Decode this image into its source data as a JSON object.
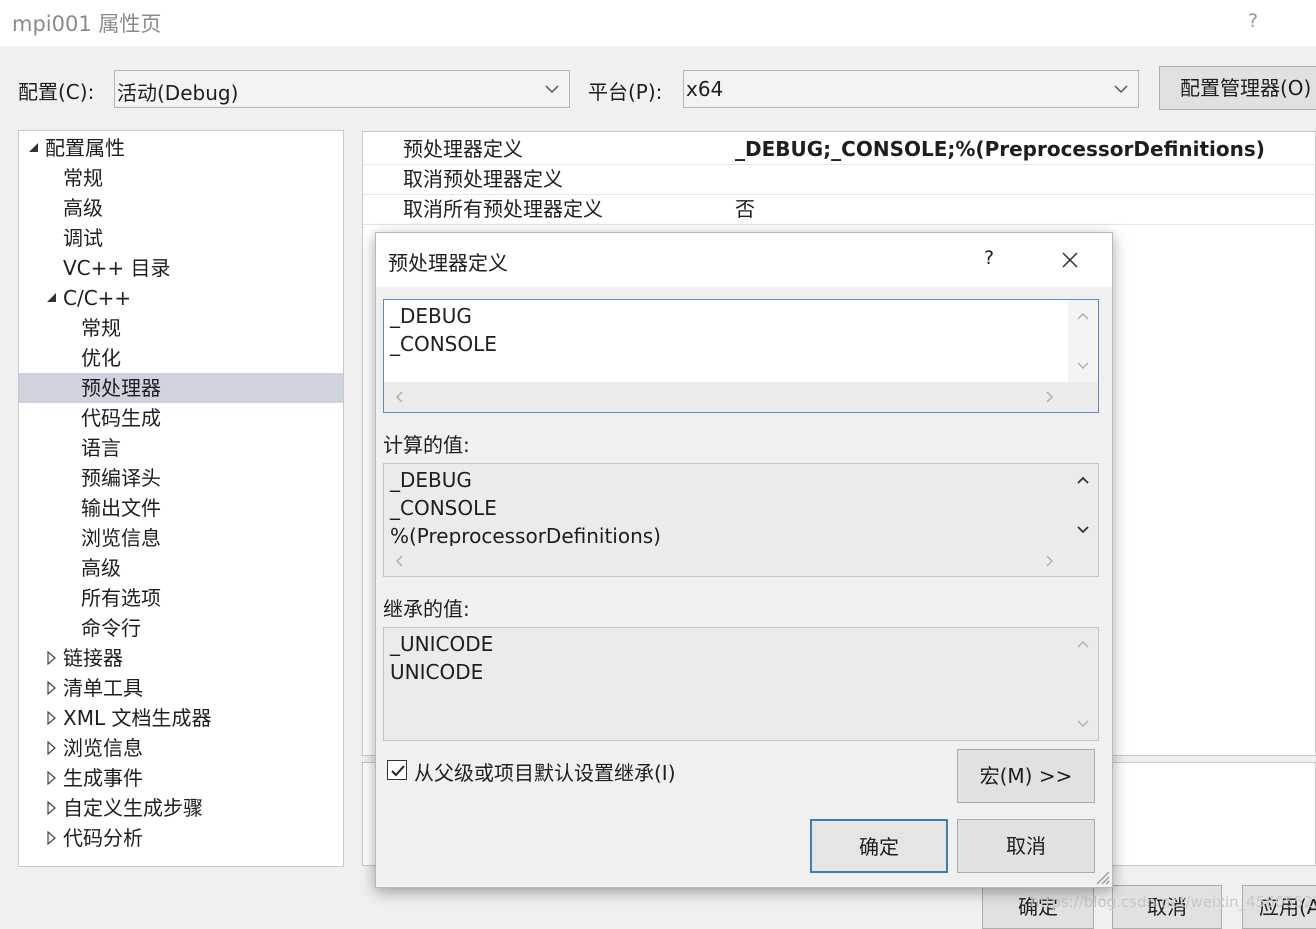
{
  "window": {
    "title": "mpi001 属性页",
    "help": "?"
  },
  "toolbar": {
    "config_label": "配置(C):",
    "config_value": "活动(Debug)",
    "platform_label": "平台(P):",
    "platform_value": "x64",
    "config_manager_button": "配置管理器(O)"
  },
  "tree": {
    "items": [
      {
        "label": "配置属性",
        "level": 0,
        "expander": "expanded"
      },
      {
        "label": "常规",
        "level": 1,
        "expander": "none"
      },
      {
        "label": "高级",
        "level": 1,
        "expander": "none"
      },
      {
        "label": "调试",
        "level": 1,
        "expander": "none"
      },
      {
        "label": "VC++ 目录",
        "level": 1,
        "expander": "none"
      },
      {
        "label": "C/C++",
        "level": 1,
        "expander": "expanded"
      },
      {
        "label": "常规",
        "level": 2,
        "expander": "none"
      },
      {
        "label": "优化",
        "level": 2,
        "expander": "none"
      },
      {
        "label": "预处理器",
        "level": 2,
        "expander": "none",
        "selected": true
      },
      {
        "label": "代码生成",
        "level": 2,
        "expander": "none"
      },
      {
        "label": "语言",
        "level": 2,
        "expander": "none"
      },
      {
        "label": "预编译头",
        "level": 2,
        "expander": "none"
      },
      {
        "label": "输出文件",
        "level": 2,
        "expander": "none"
      },
      {
        "label": "浏览信息",
        "level": 2,
        "expander": "none"
      },
      {
        "label": "高级",
        "level": 2,
        "expander": "none"
      },
      {
        "label": "所有选项",
        "level": 2,
        "expander": "none"
      },
      {
        "label": "命令行",
        "level": 2,
        "expander": "none"
      },
      {
        "label": "链接器",
        "level": 1,
        "expander": "collapsed"
      },
      {
        "label": "清单工具",
        "level": 1,
        "expander": "collapsed"
      },
      {
        "label": "XML 文档生成器",
        "level": 1,
        "expander": "collapsed"
      },
      {
        "label": "浏览信息",
        "level": 1,
        "expander": "collapsed"
      },
      {
        "label": "生成事件",
        "level": 1,
        "expander": "collapsed"
      },
      {
        "label": "自定义生成步骤",
        "level": 1,
        "expander": "collapsed"
      },
      {
        "label": "代码分析",
        "level": 1,
        "expander": "collapsed"
      }
    ]
  },
  "grid": {
    "rows": [
      {
        "name": "预处理器定义",
        "value": "_DEBUG;_CONSOLE;%(PreprocessorDefinitions)",
        "bold": true
      },
      {
        "name": "取消预处理器定义",
        "value": ""
      },
      {
        "name": "取消所有预处理器定义",
        "value": "否"
      }
    ]
  },
  "dialog": {
    "title": "预处理器定义",
    "help": "?",
    "definitions": [
      "_DEBUG",
      "_CONSOLE"
    ],
    "computed_label": "计算的值:",
    "computed_values": [
      "_DEBUG",
      "_CONSOLE",
      "%(PreprocessorDefinitions)"
    ],
    "inherited_label": "继承的值:",
    "inherited_values": [
      "_UNICODE",
      "UNICODE"
    ],
    "inherit_checkbox_label": "从父级或项目默认设置继承(I)",
    "inherit_checked": true,
    "macros_button": "宏(M) >>",
    "ok_button": "确定",
    "cancel_button": "取消"
  },
  "footer": {
    "ok_button": "确定",
    "cancel_button": "取消",
    "apply_button": "应用(A)",
    "watermark": "https://blog.csdn.net/weixin_45605523"
  },
  "colors": {
    "selection": "#cfd3dd",
    "focus_border": "#5c8ac6",
    "default_button_border": "#3c7fb1"
  }
}
